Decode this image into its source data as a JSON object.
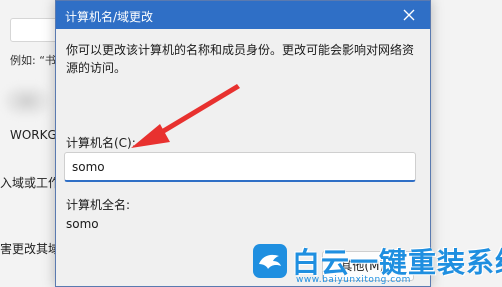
{
  "background": {
    "example_text": "例如: “书",
    "workgroup_text": "WORKG",
    "line1_text": "入域或工作",
    "line2_text": "害更改其域"
  },
  "dialog": {
    "title": "计算机名/域更改",
    "description": "你可以更改该计算机的名称和成员身份。更改可能会影响对网络资源的访问。",
    "computer_name_label": "计算机名(C):",
    "computer_name_value": "somo",
    "full_name_label": "计算机全名:",
    "full_name_value": "somo",
    "other_button_label": "其他(M)..."
  },
  "watermark": {
    "title": "白云一键重装系统",
    "url": "www.baiyunxitong.com"
  },
  "colors": {
    "accent": "#2f6fc6",
    "annotation_red": "#e8312f",
    "watermark_blue": "#1f8fe0"
  }
}
